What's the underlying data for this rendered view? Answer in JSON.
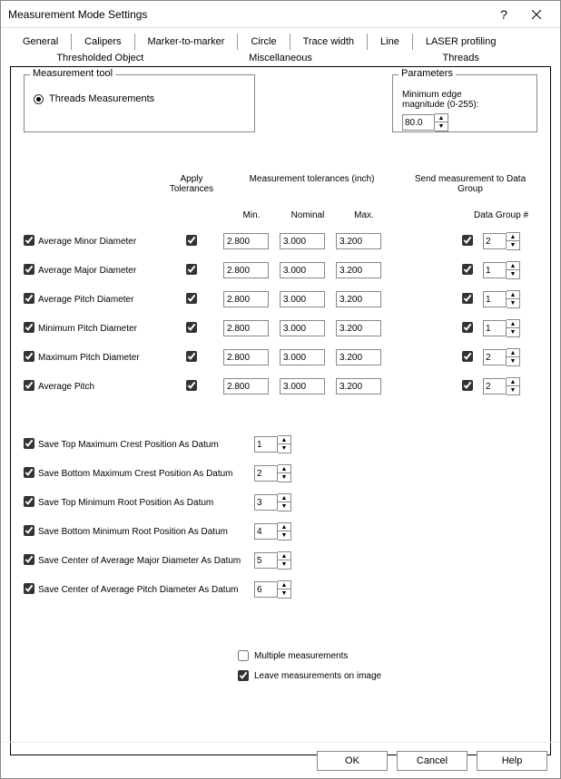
{
  "window": {
    "title": "Measurement Mode Settings"
  },
  "tabs_row1": [
    {
      "label": "General"
    },
    {
      "label": "Calipers"
    },
    {
      "label": "Marker-to-marker"
    },
    {
      "label": "Circle"
    },
    {
      "label": "Trace width"
    },
    {
      "label": "Line"
    },
    {
      "label": "LASER profiling"
    }
  ],
  "tabs_row2": [
    {
      "label": "Thresholded Object"
    },
    {
      "label": "Miscellaneous"
    },
    {
      "label": "Threads",
      "active": true
    }
  ],
  "groups": {
    "tool": {
      "title": "Measurement tool",
      "radio": "Threads Measurements"
    },
    "params": {
      "title": "Parameters",
      "label": "Minimum edge magnitude (0-255):",
      "value": "80.0"
    }
  },
  "headers": {
    "apply": "Apply Tolerances",
    "tolerances": "Measurement tolerances (inch)",
    "send": "Send measurement to Data Group",
    "min": "Min.",
    "nominal": "Nominal",
    "max": "Max.",
    "dg": "Data Group #"
  },
  "measurements": [
    {
      "enabled": true,
      "label": "Average Minor Diameter",
      "apply": true,
      "min": "2.800",
      "nom": "3.000",
      "max": "3.200",
      "send": true,
      "dg": "2"
    },
    {
      "enabled": true,
      "label": "Average Major Diameter",
      "apply": true,
      "min": "2.800",
      "nom": "3.000",
      "max": "3.200",
      "send": true,
      "dg": "1"
    },
    {
      "enabled": true,
      "label": "Average Pitch Diameter",
      "apply": true,
      "min": "2.800",
      "nom": "3.000",
      "max": "3.200",
      "send": true,
      "dg": "1"
    },
    {
      "enabled": true,
      "label": "Minimum Pitch Diameter",
      "apply": true,
      "min": "2.800",
      "nom": "3.000",
      "max": "3.200",
      "send": true,
      "dg": "1"
    },
    {
      "enabled": true,
      "label": "Maximum Pitch Diameter",
      "apply": true,
      "min": "2.800",
      "nom": "3.000",
      "max": "3.200",
      "send": true,
      "dg": "2"
    },
    {
      "enabled": true,
      "label": "Average Pitch",
      "apply": true,
      "min": "2.800",
      "nom": "3.000",
      "max": "3.200",
      "send": true,
      "dg": "2"
    }
  ],
  "datums": [
    {
      "enabled": true,
      "label": "Save Top Maximum Crest Position As Datum",
      "value": "1"
    },
    {
      "enabled": true,
      "label": "Save Bottom Maximum Crest Position As Datum",
      "value": "2"
    },
    {
      "enabled": true,
      "label": "Save Top Minimum Root Position As Datum",
      "value": "3"
    },
    {
      "enabled": true,
      "label": "Save Bottom Minimum Root Position As Datum",
      "value": "4"
    },
    {
      "enabled": true,
      "label": "Save Center of Average Major Diameter As Datum",
      "value": "5"
    },
    {
      "enabled": true,
      "label": "Save Center of Average Pitch Diameter As Datum",
      "value": "6"
    }
  ],
  "options": {
    "multiple": {
      "checked": false,
      "label": "Multiple measurements"
    },
    "leave": {
      "checked": true,
      "label": "Leave measurements on image"
    }
  },
  "buttons": {
    "ok": "OK",
    "cancel": "Cancel",
    "help": "Help"
  }
}
